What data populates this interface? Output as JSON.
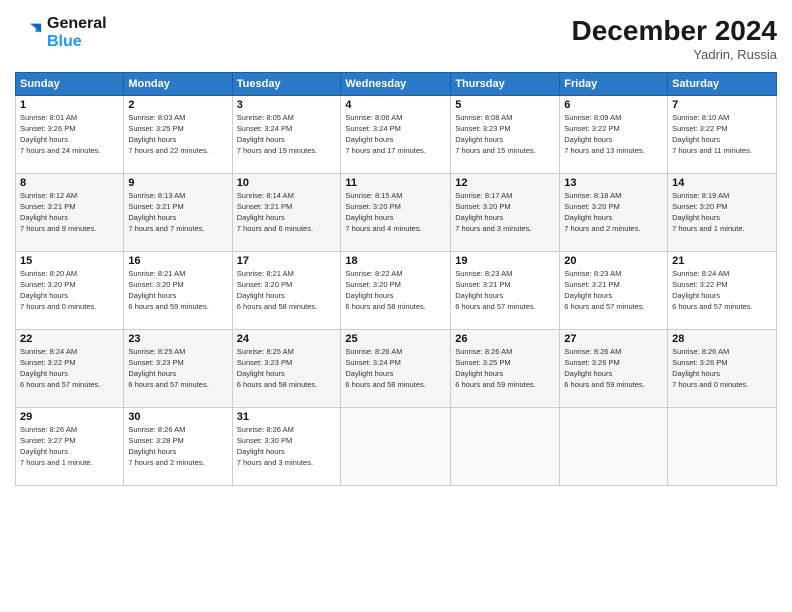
{
  "logo": {
    "line1": "General",
    "line2": "Blue"
  },
  "header": {
    "title": "December 2024",
    "location": "Yadrin, Russia"
  },
  "days_of_week": [
    "Sunday",
    "Monday",
    "Tuesday",
    "Wednesday",
    "Thursday",
    "Friday",
    "Saturday"
  ],
  "weeks": [
    [
      {
        "day": "1",
        "sunrise": "8:01 AM",
        "sunset": "3:26 PM",
        "daylight": "7 hours and 24 minutes."
      },
      {
        "day": "2",
        "sunrise": "8:03 AM",
        "sunset": "3:25 PM",
        "daylight": "7 hours and 22 minutes."
      },
      {
        "day": "3",
        "sunrise": "8:05 AM",
        "sunset": "3:24 PM",
        "daylight": "7 hours and 19 minutes."
      },
      {
        "day": "4",
        "sunrise": "8:06 AM",
        "sunset": "3:24 PM",
        "daylight": "7 hours and 17 minutes."
      },
      {
        "day": "5",
        "sunrise": "8:08 AM",
        "sunset": "3:23 PM",
        "daylight": "7 hours and 15 minutes."
      },
      {
        "day": "6",
        "sunrise": "8:09 AM",
        "sunset": "3:22 PM",
        "daylight": "7 hours and 13 minutes."
      },
      {
        "day": "7",
        "sunrise": "8:10 AM",
        "sunset": "3:22 PM",
        "daylight": "7 hours and 11 minutes."
      }
    ],
    [
      {
        "day": "8",
        "sunrise": "8:12 AM",
        "sunset": "3:21 PM",
        "daylight": "7 hours and 9 minutes."
      },
      {
        "day": "9",
        "sunrise": "8:13 AM",
        "sunset": "3:21 PM",
        "daylight": "7 hours and 7 minutes."
      },
      {
        "day": "10",
        "sunrise": "8:14 AM",
        "sunset": "3:21 PM",
        "daylight": "7 hours and 6 minutes."
      },
      {
        "day": "11",
        "sunrise": "8:15 AM",
        "sunset": "3:20 PM",
        "daylight": "7 hours and 4 minutes."
      },
      {
        "day": "12",
        "sunrise": "8:17 AM",
        "sunset": "3:20 PM",
        "daylight": "7 hours and 3 minutes."
      },
      {
        "day": "13",
        "sunrise": "8:18 AM",
        "sunset": "3:20 PM",
        "daylight": "7 hours and 2 minutes."
      },
      {
        "day": "14",
        "sunrise": "8:19 AM",
        "sunset": "3:20 PM",
        "daylight": "7 hours and 1 minute."
      }
    ],
    [
      {
        "day": "15",
        "sunrise": "8:20 AM",
        "sunset": "3:20 PM",
        "daylight": "7 hours and 0 minutes."
      },
      {
        "day": "16",
        "sunrise": "8:21 AM",
        "sunset": "3:20 PM",
        "daylight": "6 hours and 59 minutes."
      },
      {
        "day": "17",
        "sunrise": "8:21 AM",
        "sunset": "3:20 PM",
        "daylight": "6 hours and 58 minutes."
      },
      {
        "day": "18",
        "sunrise": "8:22 AM",
        "sunset": "3:20 PM",
        "daylight": "6 hours and 58 minutes."
      },
      {
        "day": "19",
        "sunrise": "8:23 AM",
        "sunset": "3:21 PM",
        "daylight": "6 hours and 57 minutes."
      },
      {
        "day": "20",
        "sunrise": "8:23 AM",
        "sunset": "3:21 PM",
        "daylight": "6 hours and 57 minutes."
      },
      {
        "day": "21",
        "sunrise": "8:24 AM",
        "sunset": "3:22 PM",
        "daylight": "6 hours and 57 minutes."
      }
    ],
    [
      {
        "day": "22",
        "sunrise": "8:24 AM",
        "sunset": "3:22 PM",
        "daylight": "6 hours and 57 minutes."
      },
      {
        "day": "23",
        "sunrise": "8:25 AM",
        "sunset": "3:23 PM",
        "daylight": "6 hours and 57 minutes."
      },
      {
        "day": "24",
        "sunrise": "8:25 AM",
        "sunset": "3:23 PM",
        "daylight": "6 hours and 58 minutes."
      },
      {
        "day": "25",
        "sunrise": "8:26 AM",
        "sunset": "3:24 PM",
        "daylight": "6 hours and 58 minutes."
      },
      {
        "day": "26",
        "sunrise": "8:26 AM",
        "sunset": "3:25 PM",
        "daylight": "6 hours and 59 minutes."
      },
      {
        "day": "27",
        "sunrise": "8:26 AM",
        "sunset": "3:26 PM",
        "daylight": "6 hours and 59 minutes."
      },
      {
        "day": "28",
        "sunrise": "8:26 AM",
        "sunset": "3:26 PM",
        "daylight": "7 hours and 0 minutes."
      }
    ],
    [
      {
        "day": "29",
        "sunrise": "8:26 AM",
        "sunset": "3:27 PM",
        "daylight": "7 hours and 1 minute."
      },
      {
        "day": "30",
        "sunrise": "8:26 AM",
        "sunset": "3:28 PM",
        "daylight": "7 hours and 2 minutes."
      },
      {
        "day": "31",
        "sunrise": "8:26 AM",
        "sunset": "3:30 PM",
        "daylight": "7 hours and 3 minutes."
      },
      null,
      null,
      null,
      null
    ]
  ]
}
